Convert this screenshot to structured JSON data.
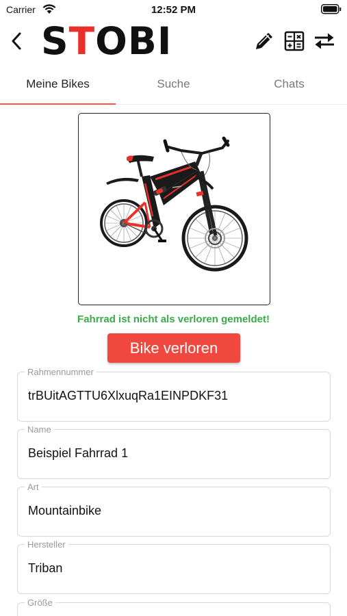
{
  "status_bar": {
    "carrier": "Carrier",
    "time": "12:52 PM"
  },
  "header": {
    "logo_red": "ST",
    "logo_black": "OBI"
  },
  "tabs": [
    {
      "label": "Meine Bikes",
      "active": true
    },
    {
      "label": "Suche",
      "active": false
    },
    {
      "label": "Chats",
      "active": false
    }
  ],
  "status": {
    "message": "Fahrrad ist nicht als verloren gemeldet!"
  },
  "actions": {
    "lost_button": "Bike verloren"
  },
  "fields": [
    {
      "label": "Rahmennummer",
      "value": "trBUitAGTTU6XlxuqRa1EINPDKF31"
    },
    {
      "label": "Name",
      "value": "Beispiel Fahrrad 1"
    },
    {
      "label": "Art",
      "value": "Mountainbike"
    },
    {
      "label": "Hersteller",
      "value": "Triban"
    },
    {
      "label": "Größe",
      "value": ""
    }
  ],
  "colors": {
    "brand_red": "#e8312b",
    "status_green": "#3bab4a",
    "button_red": "#f0483e",
    "tab_indicator": "#ee5a4c"
  }
}
